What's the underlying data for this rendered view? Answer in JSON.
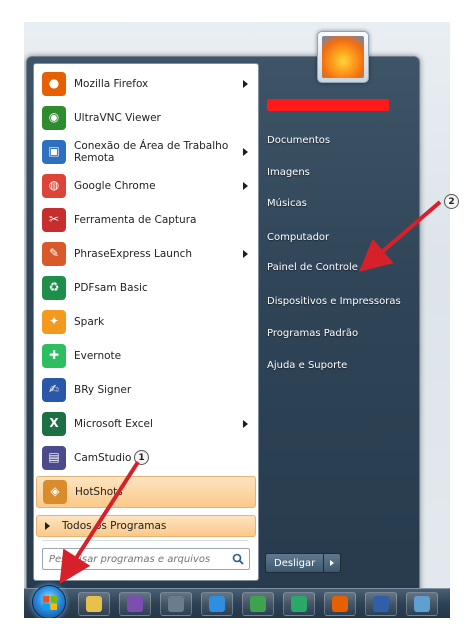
{
  "programs": [
    {
      "label": "Mozilla Firefox",
      "icon": "firefox-icon",
      "color": "#e66000",
      "has_submenu": true
    },
    {
      "label": "UltraVNC Viewer",
      "icon": "ultravnc-icon",
      "color": "#2e8b2e",
      "has_submenu": false
    },
    {
      "label": "Conexão de Área de Trabalho\nRemota",
      "icon": "remote-desktop-icon",
      "color": "#2f6fbf",
      "has_submenu": true
    },
    {
      "label": "Google Chrome",
      "icon": "chrome-icon",
      "color": "#db4437",
      "has_submenu": true
    },
    {
      "label": "Ferramenta de Captura",
      "icon": "scissors-icon",
      "color": "#c62d2d",
      "has_submenu": false
    },
    {
      "label": "PhraseExpress Launch",
      "icon": "phraseexpress-icon",
      "color": "#d85a2a",
      "has_submenu": true
    },
    {
      "label": "PDFsam Basic",
      "icon": "pdfsam-icon",
      "color": "#1e8f4a",
      "has_submenu": false
    },
    {
      "label": "Spark",
      "icon": "spark-icon",
      "color": "#f39a1e",
      "has_submenu": false
    },
    {
      "label": "Evernote",
      "icon": "evernote-icon",
      "color": "#2dbe60",
      "has_submenu": false
    },
    {
      "label": "BRy Signer",
      "icon": "bry-signer-icon",
      "color": "#2b57a8",
      "has_submenu": false
    },
    {
      "label": "Microsoft Excel",
      "icon": "excel-icon",
      "color": "#1d7044",
      "has_submenu": true
    },
    {
      "label": "CamStudio",
      "icon": "camstudio-icon",
      "color": "#4a4a8c",
      "has_submenu": false
    },
    {
      "label": "HotShots",
      "icon": "hotshots-icon",
      "color": "#d98c2b",
      "has_submenu": false
    }
  ],
  "all_programs_label": "Todos os Programas",
  "search": {
    "placeholder": "Pesquisar programas e arquivos"
  },
  "right_pane": {
    "items": [
      "Documentos",
      "Imagens",
      "Músicas",
      "Computador",
      "Painel de Controle",
      "Dispositivos e Impressoras",
      "Programas Padrão",
      "Ajuda e Suporte"
    ]
  },
  "shutdown_label": "Desligar",
  "callouts": [
    "1",
    "2"
  ],
  "taskbar_icons": [
    "explorer-icon",
    "vs-icon",
    "network-icon",
    "ie-icon",
    "calc-icon",
    "media-icon",
    "firefox-icon",
    "virtualbox-icon",
    "remote-icon"
  ],
  "colors": {
    "highlight": "#fbc98a",
    "arrow": "#d6202a",
    "redaction": "#ff1a1a"
  }
}
